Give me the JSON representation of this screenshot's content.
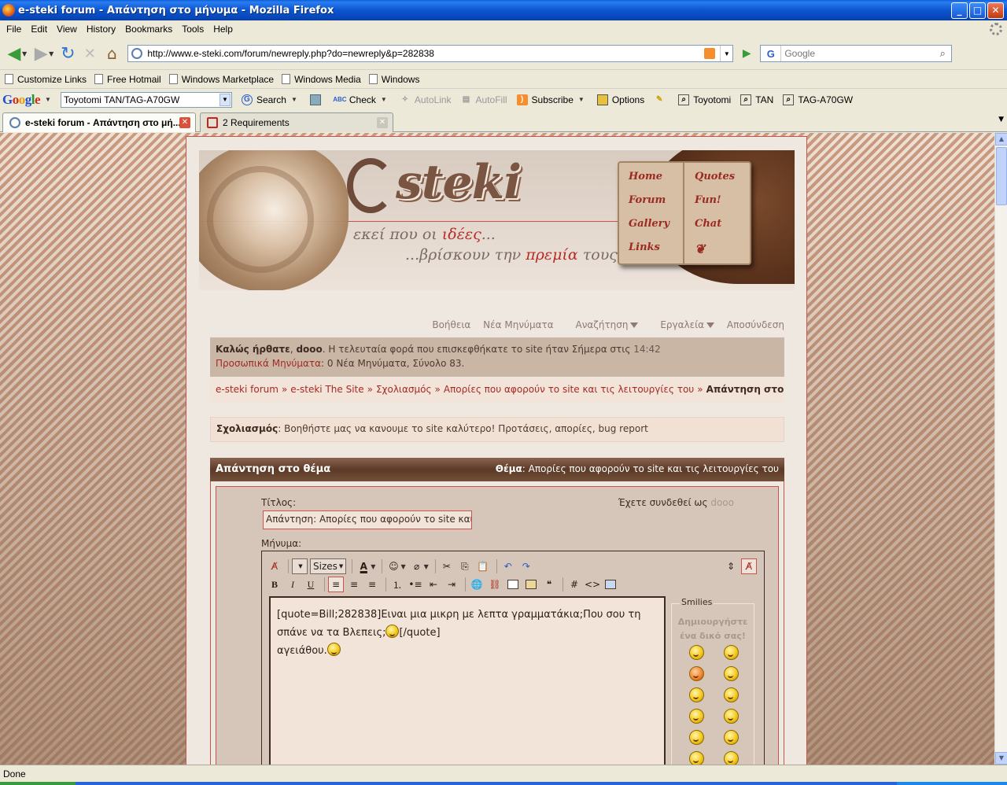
{
  "window": {
    "title": "e-steki forum - Απάντηση στο μήνυμα - Mozilla Firefox",
    "minimize": "_",
    "maximize": "□",
    "close": "✕"
  },
  "menu": [
    "File",
    "Edit",
    "View",
    "History",
    "Bookmarks",
    "Tools",
    "Help"
  ],
  "navigation": {
    "url": "http://www.e-steki.com/forum/newreply.php?do=newreply&p=282838",
    "search_engine": "G",
    "search_placeholder": "Google"
  },
  "bookmarks": [
    "Customize Links",
    "Free Hotmail",
    "Windows Marketplace",
    "Windows Media",
    "Windows"
  ],
  "google_toolbar": {
    "logo": [
      "G",
      "o",
      "o",
      "g",
      "l",
      "e"
    ],
    "query": "Toyotomi TAN/TAG-A70GW",
    "buttons": [
      "Search",
      "Check",
      "AutoLink",
      "AutoFill",
      "Subscribe",
      "Options"
    ],
    "highlights": [
      "Toyotomi",
      "TAN",
      "TAG-A70GW"
    ]
  },
  "tabs": [
    {
      "label": "e-steki forum - Απάντηση στο μή...",
      "active": true
    },
    {
      "label": "2 Requirements",
      "active": false
    }
  ],
  "site": {
    "logo": "steki",
    "slogan_line1_pre": "εκεί που οι ",
    "slogan_line1_em": "ιδέες",
    "slogan_line1_post": "...",
    "slogan_line2_pre": "...βρίσκουν την ",
    "slogan_line2_em": "πρεμία",
    "slogan_line2_post": " τους",
    "book_links_left": [
      "Home",
      "Forum",
      "Gallery",
      "Links"
    ],
    "book_links_right": [
      "Quotes",
      "Fun!",
      "Chat"
    ]
  },
  "top_nav": [
    "Βοήθεια",
    "Νέα Μηνύματα",
    "Αναζήτηση",
    "Εργαλεία",
    "Αποσύνδεση"
  ],
  "welcome": {
    "greeting": "Καλώς ήρθατε",
    "sep": ", ",
    "user": "dooo",
    "text": ". Η τελευταία φορά που επισκεφθήκατε το site ήταν Σήμερα στις ",
    "time": "14:42",
    "pm_label": "Προσωπικά Μηνύματα",
    "pm_text": ": 0 Νέα Μηνύματα, Σύνολο 83."
  },
  "breadcrumb": [
    "e-steki forum",
    "e-steki The Site",
    "Σχολιασμός",
    "Απορίες που αφορούν το site και τις λειτουργίες του"
  ],
  "breadcrumb_sep": "»",
  "breadcrumb_current": "Απάντηση στο θέμα",
  "forum_desc": {
    "name": "Σχολιασμός",
    "text": ": Βοηθήστε μας να κανουμε το site καλύτερο! Προτάσεις, απορίες, bug report"
  },
  "reply_panel": {
    "heading": "Απάντηση στο θέμα",
    "thread_label": "Θέμα",
    "thread_title": ": Απορίες που αφορούν το site και τις λειτουργίες του",
    "title_label": "Τίτλος:",
    "title_value": "Απάντηση: Απορίες που αφορούν το site και τις",
    "logged_in_label": "Έχετε συνδεθεί ως ",
    "logged_in_user": "dooo",
    "message_label": "Μήνυμα:",
    "font_size": "Sizes",
    "message_line1": "[quote=Bill;282838]Ειναι μια μικρη με λεπτα γραμματάκια;Που σου τη σπάνε να τα Βλεπεις;",
    "message_line1_end": "[/quote]",
    "message_line2": "αγειάθου.",
    "smilies_legend": "Smilies",
    "smilies_create": "Δημιουργήστε ένα δικό σας!"
  },
  "status": "Done"
}
